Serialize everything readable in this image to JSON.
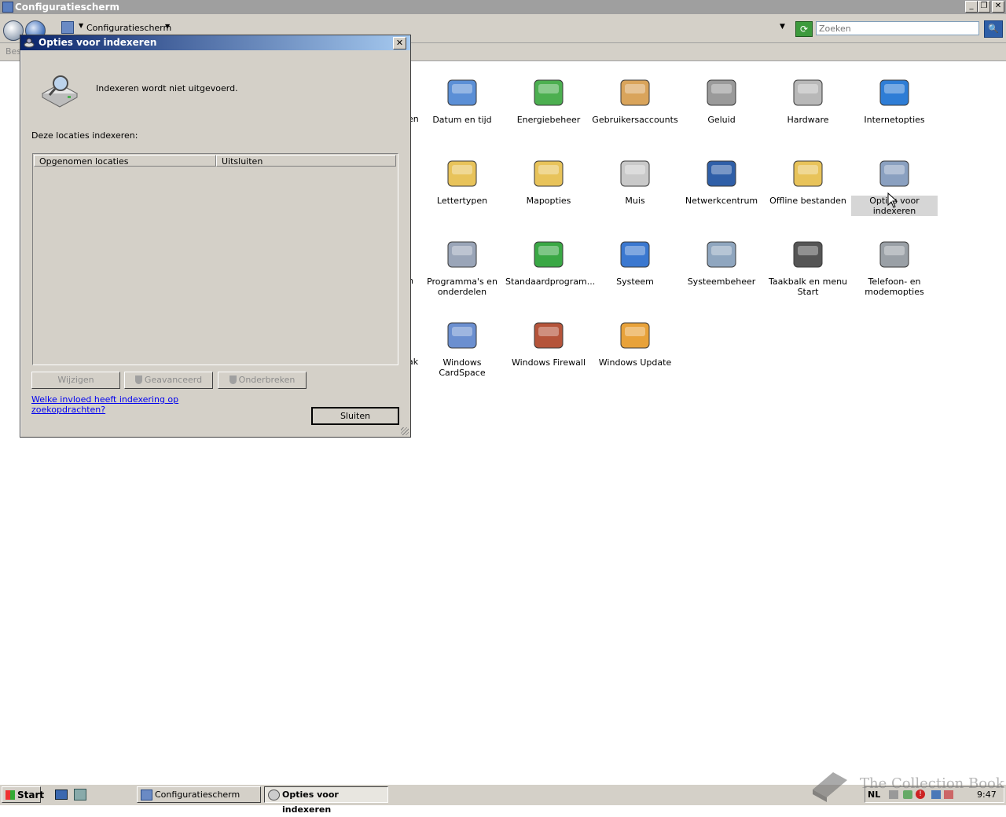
{
  "window": {
    "title": "Configuratiescherm"
  },
  "address": {
    "breadcrumb": "Configuratiescherm",
    "search_placeholder": "Zoeken",
    "menu_partial": "Bes"
  },
  "control_panel": {
    "partial_labels": [
      "en",
      "n",
      "ak"
    ],
    "items": [
      {
        "id": "datum-en-tijd",
        "label": "Datum en tijd",
        "icon": "calendar-clock-icon"
      },
      {
        "id": "energiebeheer",
        "label": "Energiebeheer",
        "icon": "battery-plug-icon"
      },
      {
        "id": "gebruikersaccounts",
        "label": "Gebruikersaccounts",
        "icon": "users-icon"
      },
      {
        "id": "geluid",
        "label": "Geluid",
        "icon": "speaker-icon"
      },
      {
        "id": "hardware",
        "label": "Hardware",
        "icon": "hardware-icon"
      },
      {
        "id": "internetopties",
        "label": "Internetopties",
        "icon": "globe-icon"
      },
      {
        "id": "lettertypen",
        "label": "Lettertypen",
        "icon": "font-folder-icon"
      },
      {
        "id": "mapopties",
        "label": "Mapopties",
        "icon": "folder-options-icon"
      },
      {
        "id": "muis",
        "label": "Muis",
        "icon": "mouse-icon"
      },
      {
        "id": "netwerkcentrum",
        "label": "Netwerkcentrum",
        "icon": "network-icon"
      },
      {
        "id": "offline-bestanden",
        "label": "Offline bestanden",
        "icon": "sync-folder-icon"
      },
      {
        "id": "opties-voor-indexeren",
        "label": "Opties voor indexeren",
        "icon": "indexing-icon",
        "selected": true
      },
      {
        "id": "programmas-en-onderdelen",
        "label": "Programma's en onderdelen",
        "icon": "programs-icon"
      },
      {
        "id": "standaardprogrammas",
        "label": "Standaardprogram...",
        "icon": "default-programs-icon"
      },
      {
        "id": "systeem",
        "label": "Systeem",
        "icon": "computer-icon"
      },
      {
        "id": "systeembeheer",
        "label": "Systeembeheer",
        "icon": "admin-tools-icon"
      },
      {
        "id": "taakbalk-en-menu-start",
        "label": "Taakbalk en menu Start",
        "icon": "taskbar-icon"
      },
      {
        "id": "telefoon-en-modemopties",
        "label": "Telefoon- en modemopties",
        "icon": "phone-icon"
      },
      {
        "id": "windows-cardspace",
        "label": "Windows CardSpace",
        "icon": "cardspace-icon"
      },
      {
        "id": "windows-firewall",
        "label": "Windows Firewall",
        "icon": "firewall-icon"
      },
      {
        "id": "windows-update",
        "label": "Windows Update",
        "icon": "windows-update-icon"
      }
    ]
  },
  "dialog": {
    "title": "Opties voor indexeren",
    "status": "Indexeren wordt niet uitgevoerd.",
    "locations_label": "Deze locaties indexeren:",
    "columns": [
      "Opgenomen locaties",
      "Uitsluiten"
    ],
    "buttons": {
      "change": "Wijzigen",
      "advanced": "Geavanceerd",
      "pause": "Onderbreken",
      "close": "Sluiten"
    },
    "help_link": "Welke invloed heeft indexering op zoekopdrachten?"
  },
  "taskbar": {
    "start": "Start",
    "tasks": [
      {
        "label": "Configuratiescherm",
        "active": false
      },
      {
        "label": "Opties voor indexeren",
        "active": true
      }
    ],
    "language": "NL",
    "clock": "9:47"
  },
  "watermark": "The Collection Book",
  "colors": {
    "title_active_start": "#0a246a",
    "title_active_end": "#a6caf0",
    "face": "#d4d0c8",
    "link": "#0000ee"
  }
}
